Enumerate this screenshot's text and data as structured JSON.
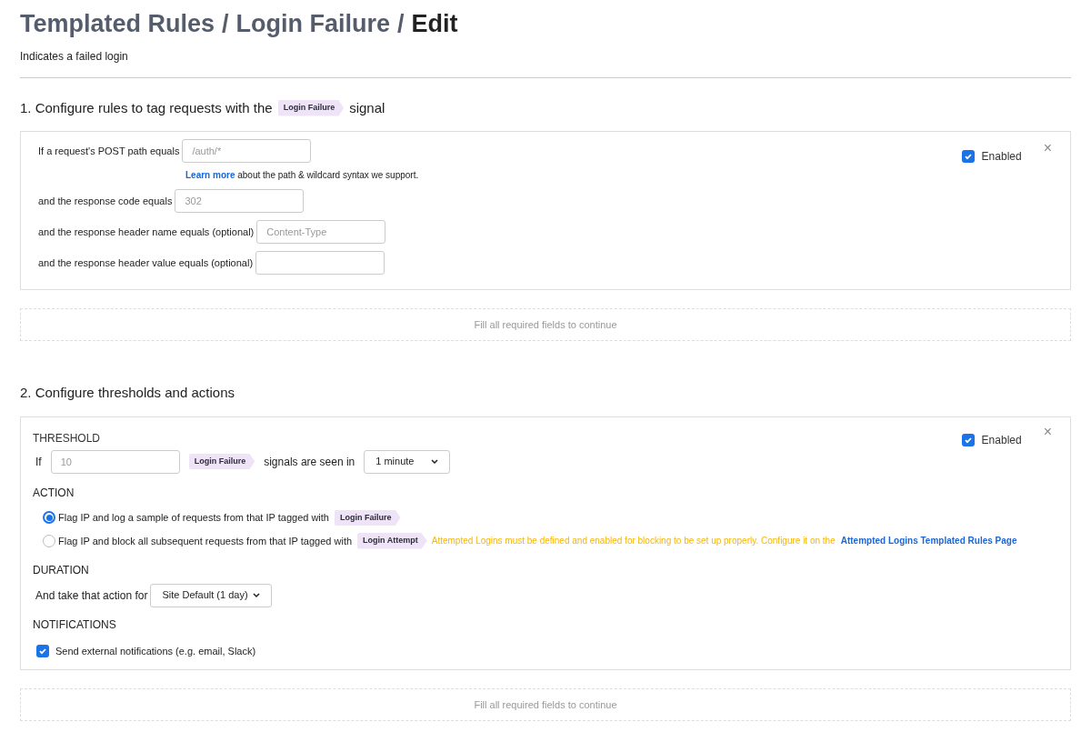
{
  "title": {
    "crumbs": [
      {
        "label": "Templated Rules",
        "current": false
      },
      {
        "label": "Login Failure",
        "current": false
      },
      {
        "label": "Edit",
        "current": true
      }
    ],
    "separator": "/"
  },
  "description": "Indicates a failed login",
  "section_1": {
    "heading_before": "1. Configure rules to tag requests with the",
    "tag": "Login Failure",
    "heading_after": "signal",
    "enabled": {
      "label": "Enabled",
      "checked": true
    },
    "close": "×",
    "conditions": [
      {
        "label": "If a request's POST path equals",
        "placeholder": "/auth/*"
      },
      {
        "label": "and the response code equals",
        "placeholder": "302"
      },
      {
        "label": "and the response header name equals (optional)",
        "placeholder": "Content-Type"
      },
      {
        "label": "and the response header value equals (optional)"
      }
    ],
    "help": {
      "link": "Learn more",
      "text": "about the path & wildcard syntax we support."
    },
    "footer": "Fill all required fields to continue"
  },
  "section_2": {
    "heading": "2. Configure thresholds and actions",
    "enabled": {
      "label": "Enabled",
      "checked": true
    },
    "close": "×",
    "threshold": {
      "heading": "THRESHOLD",
      "if": "If",
      "placeholder": "10",
      "tag": "Login Failure",
      "text": "signals are seen in",
      "interval": "1 minute"
    },
    "action": {
      "heading": "ACTION",
      "options": [
        {
          "label": "Flag IP and log a sample of requests from that IP tagged with",
          "tag": "Login Failure",
          "selected": true
        },
        {
          "label": "Flag IP and block all subsequent requests from that IP tagged with",
          "tag": "Login Attempt",
          "selected": false,
          "warning": "Attempted Logins must be defined and enabled for blocking to be set up properly. Configure it on the",
          "link": "Attempted Logins Templated Rules Page"
        }
      ]
    },
    "duration": {
      "heading": "DURATION",
      "label": "And take that action for",
      "value": "Site Default (1 day)"
    },
    "notifications": {
      "heading": "NOTIFICATIONS",
      "label": "Send external notifications (e.g. email, Slack)",
      "checked": true
    },
    "footer": "Fill all required fields to continue"
  }
}
